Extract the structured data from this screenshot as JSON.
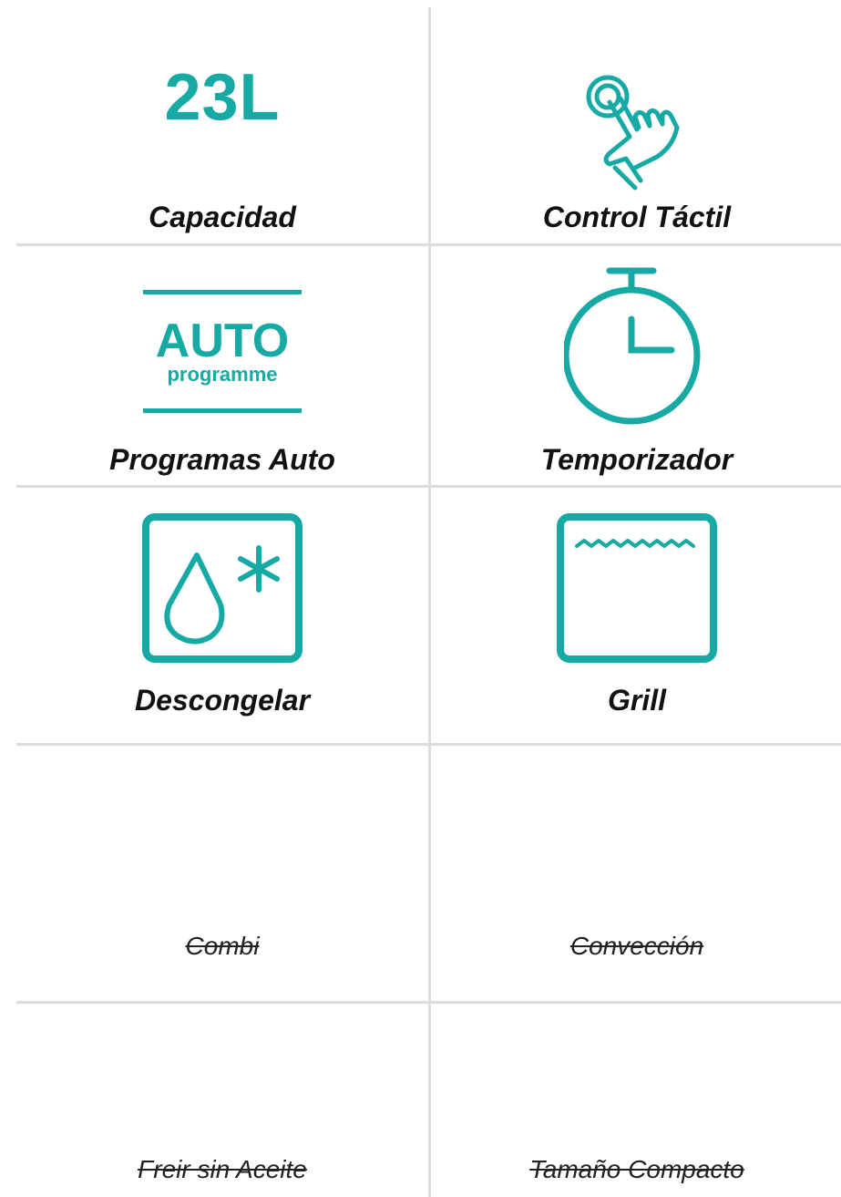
{
  "colors": {
    "accent": "#17aaa5",
    "divider": "#dcdcdc",
    "text": "#111111"
  },
  "features": {
    "capacity": {
      "value": "23L",
      "label": "Capacidad"
    },
    "touch_control": {
      "icon": "touch-hand-icon",
      "label": "Control Táctil"
    },
    "auto_programs": {
      "icon_title": "AUTO",
      "icon_subtitle": "programme",
      "label": "Programas Auto"
    },
    "timer": {
      "icon": "stopwatch-icon",
      "label": "Temporizador"
    },
    "defrost": {
      "icon": "defrost-icon",
      "label": "Descongelar"
    },
    "grill": {
      "icon": "grill-icon",
      "label": "Grill"
    },
    "combi": {
      "label": "Combi"
    },
    "convection": {
      "label": "Convección"
    },
    "air_fry": {
      "label": "Freir sin Aceite"
    },
    "compact": {
      "label": "Tamaño Compacto"
    }
  }
}
